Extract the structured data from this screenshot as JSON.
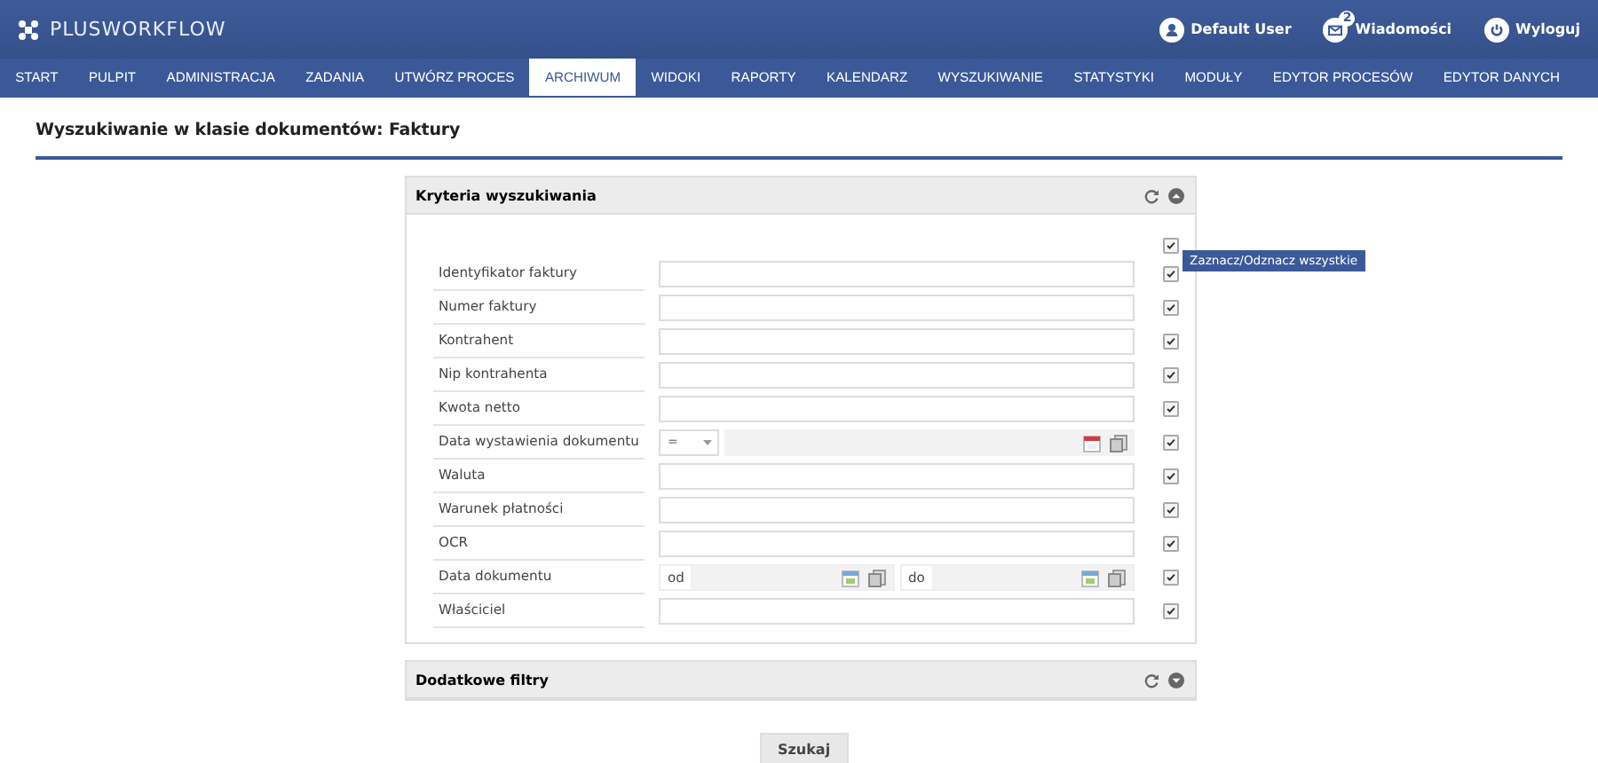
{
  "header": {
    "logo": "PLUSWORKFLOW",
    "user": "Default User",
    "messages": {
      "label": "Wiadomości",
      "badge": "2"
    },
    "logout": "Wyloguj"
  },
  "nav": [
    {
      "label": "START",
      "selected": false
    },
    {
      "label": "PULPIT",
      "selected": false
    },
    {
      "label": "ADMINISTRACJA",
      "selected": false
    },
    {
      "label": "ZADANIA",
      "selected": false
    },
    {
      "label": "UTWÓRZ PROCES",
      "selected": false
    },
    {
      "label": "ARCHIWUM",
      "selected": true
    },
    {
      "label": "WIDOKI",
      "selected": false
    },
    {
      "label": "RAPORTY",
      "selected": false
    },
    {
      "label": "KALENDARZ",
      "selected": false
    },
    {
      "label": "WYSZUKIWANIE",
      "selected": false
    },
    {
      "label": "STATYSTYKI",
      "selected": false
    },
    {
      "label": "MODUŁY",
      "selected": false
    },
    {
      "label": "EDYTOR PROCESÓW",
      "selected": false
    },
    {
      "label": "EDYTOR DANYCH",
      "selected": false
    }
  ],
  "page_title": "Wyszukiwanie w klasie dokumentów: Faktury",
  "criteria_panel": {
    "title": "Kryteria wyszukiwania",
    "expanded": true,
    "select_all": {
      "checked": true,
      "tooltip": "Zaznacz/Odznacz wszystkie"
    },
    "fields": [
      {
        "kind": "text",
        "label": "Identyfikator faktury",
        "checked": true
      },
      {
        "kind": "text",
        "label": "Numer faktury",
        "checked": true
      },
      {
        "kind": "text",
        "label": "Kontrahent",
        "checked": true
      },
      {
        "kind": "text",
        "label": "Nip kontrahenta",
        "checked": true
      },
      {
        "kind": "text",
        "label": "Kwota netto",
        "checked": true
      },
      {
        "kind": "date",
        "label": "Data wystawienia dokumentu",
        "operator": "=",
        "checked": true
      },
      {
        "kind": "text",
        "label": "Waluta",
        "checked": true
      },
      {
        "kind": "text",
        "label": "Warunek płatności",
        "checked": true
      },
      {
        "kind": "text",
        "label": "OCR",
        "checked": true
      },
      {
        "kind": "range",
        "label": "Data dokumentu",
        "from": "od",
        "to": "do",
        "checked": true
      },
      {
        "kind": "text",
        "label": "Właściciel",
        "checked": true
      }
    ]
  },
  "filters_panel": {
    "title": "Dodatkowe filtry",
    "expanded": false
  },
  "search_button": "Szukaj"
}
